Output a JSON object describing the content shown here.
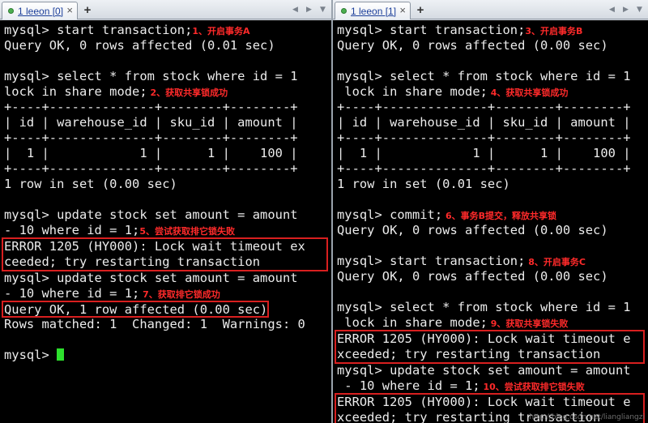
{
  "left_pane": {
    "tab_label": "1 leeon [0]",
    "lines": [
      {
        "text": "mysql> start transaction;",
        "ann": "1、开启事务A"
      },
      {
        "text": "Query OK, 0 rows affected (0.01 sec)"
      },
      {
        "text": ""
      },
      {
        "text": "mysql> select * from stock where id = 1"
      },
      {
        "text": "lock in share mode;",
        "ann": " 2、获取共享锁成功"
      },
      {
        "text": "+----+--------------+--------+--------+"
      },
      {
        "text": "| id | warehouse_id | sku_id | amount |"
      },
      {
        "text": "+----+--------------+--------+--------+"
      },
      {
        "text": "|  1 |            1 |      1 |    100 |"
      },
      {
        "text": "+----+--------------+--------+--------+"
      },
      {
        "text": "1 row in set (0.00 sec)"
      },
      {
        "text": ""
      },
      {
        "text": "mysql> update stock set amount = amount"
      },
      {
        "text": "- 10 where id = 1;",
        "ann": "5、尝试获取排它锁失败"
      },
      {
        "text": "ERROR 1205 (HY000): Lock wait timeout ex",
        "box": "top"
      },
      {
        "text": "ceeded; try restarting transaction",
        "box": "bottom"
      },
      {
        "text": "mysql> update stock set amount = amount"
      },
      {
        "text": "- 10 where id = 1;",
        "ann": " 7、获取排它锁成功"
      },
      {
        "text": "Query OK, 1 row affected (0.00 sec)",
        "box": "single"
      },
      {
        "text": "Rows matched: 1  Changed: 1  Warnings: 0"
      },
      {
        "text": ""
      },
      {
        "text": "mysql> ",
        "cursor": true
      }
    ]
  },
  "right_pane": {
    "tab_label": "1 leeon [1]",
    "watermark": "http://blog.csdn.net/liangliangzi",
    "lines": [
      {
        "text": "mysql> start transaction;",
        "ann": "3、开启事务B"
      },
      {
        "text": "Query OK, 0 rows affected (0.00 sec)"
      },
      {
        "text": ""
      },
      {
        "text": "mysql> select * from stock where id = 1"
      },
      {
        "text": " lock in share mode;",
        "ann": " 4、获取共享锁成功"
      },
      {
        "text": "+----+--------------+--------+--------+"
      },
      {
        "text": "| id | warehouse_id | sku_id | amount |"
      },
      {
        "text": "+----+--------------+--------+--------+"
      },
      {
        "text": "|  1 |            1 |      1 |    100 |"
      },
      {
        "text": "+----+--------------+--------+--------+"
      },
      {
        "text": "1 row in set (0.01 sec)"
      },
      {
        "text": ""
      },
      {
        "text": "mysql> commit;",
        "ann": " 6、事务B提交，释放共享锁"
      },
      {
        "text": "Query OK, 0 rows affected (0.00 sec)"
      },
      {
        "text": ""
      },
      {
        "text": "mysql> start transaction;",
        "ann": " 8、开启事务C"
      },
      {
        "text": "Query OK, 0 rows affected (0.00 sec)"
      },
      {
        "text": ""
      },
      {
        "text": "mysql> select * from stock where id = 1"
      },
      {
        "text": " lock in share mode;",
        "ann": " 9、获取共享锁失败"
      },
      {
        "text": "ERROR 1205 (HY000): Lock wait timeout e",
        "box": "top"
      },
      {
        "text": "xceeded; try restarting transaction",
        "box": "bottom"
      },
      {
        "text": "mysql> update stock set amount = amount"
      },
      {
        "text": " - 10 where id = 1;",
        "ann": " 10、尝试获取排它锁失败"
      },
      {
        "text": "ERROR 1205 (HY000): Lock wait timeout e",
        "box": "top"
      },
      {
        "text": "xceeded; try restarting transaction",
        "box": "bottom"
      }
    ]
  },
  "colors": {
    "terminal_bg": "#000000",
    "terminal_fg": "#ececec",
    "annotation": "#ff2a2a",
    "highlight_box": "#d81f1f",
    "cursor": "#2de02d"
  }
}
